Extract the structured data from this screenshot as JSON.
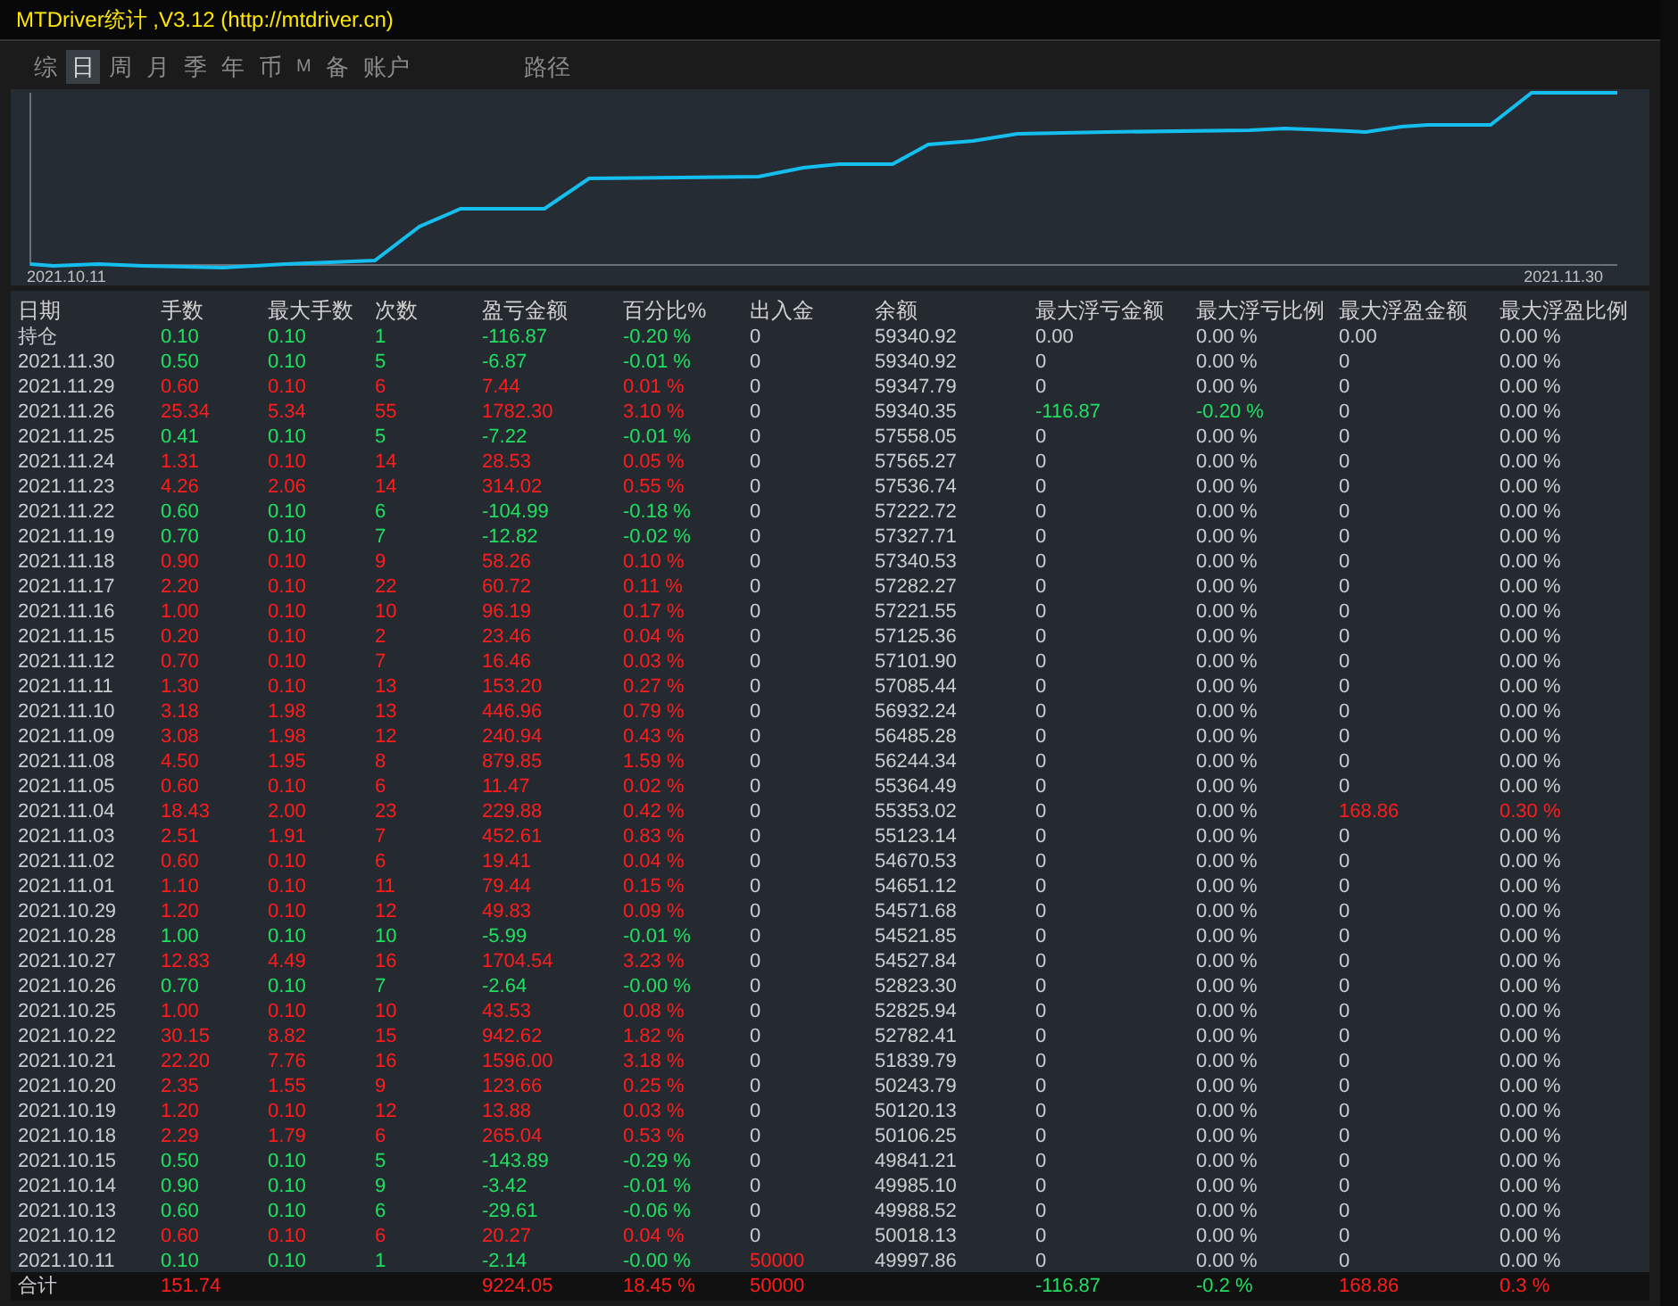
{
  "window": {
    "title": "MTDriver统计 ,V3.12 (http://mtdriver.cn)"
  },
  "tabs": [
    {
      "label": "综",
      "selected": false
    },
    {
      "label": "日",
      "selected": true
    },
    {
      "label": "周",
      "selected": false
    },
    {
      "label": "月",
      "selected": false
    },
    {
      "label": "季",
      "selected": false
    },
    {
      "label": "年",
      "selected": false
    },
    {
      "label": "币",
      "selected": false
    },
    {
      "label": "M",
      "selected": false
    },
    {
      "label": "备",
      "selected": false
    },
    {
      "label": "账户",
      "selected": false
    },
    {
      "label": "路径",
      "selected": false
    }
  ],
  "chart": {
    "start_label": "2021.10.11",
    "end_label": "2021.11.30"
  },
  "table": {
    "columns": [
      "日期",
      "手数",
      "最大手数",
      "次数",
      "盈亏金额",
      "百分比%",
      "出入金",
      "余额",
      "最大浮亏金额",
      "最大浮亏比例",
      "最大浮盈金额",
      "最大浮盈比例"
    ],
    "rows": [
      {
        "color": "#1fe060",
        "cells": [
          "持仓",
          "0.10",
          "0.10",
          "1",
          "-116.87",
          "-0.20 %",
          "0",
          "59340.92",
          "0.00",
          "0.00 %",
          "0.00",
          "0.00 %"
        ]
      },
      {
        "color": "#1fe060",
        "cells": [
          "2021.11.30",
          "0.50",
          "0.10",
          "5",
          "-6.87",
          "-0.01 %",
          "0",
          "59340.92",
          "0",
          "0.00 %",
          "0",
          "0.00 %"
        ]
      },
      {
        "color": "#ff1c1c",
        "cells": [
          "2021.11.29",
          "0.60",
          "0.10",
          "6",
          "7.44",
          "0.01 %",
          "0",
          "59347.79",
          "0",
          "0.00 %",
          "0",
          "0.00 %"
        ]
      },
      {
        "color": "#ff1c1c",
        "cells": [
          "2021.11.26",
          "25.34",
          "5.34",
          "55",
          "1782.30",
          "3.10 %",
          "0",
          "59340.35",
          {
            "text": "-116.87",
            "color": "#1fe060"
          },
          {
            "text": "-0.20 %",
            "color": "#1fe060"
          },
          "0",
          "0.00 %"
        ]
      },
      {
        "color": "#1fe060",
        "cells": [
          "2021.11.25",
          "0.41",
          "0.10",
          "5",
          "-7.22",
          "-0.01 %",
          "0",
          "57558.05",
          "0",
          "0.00 %",
          "0",
          "0.00 %"
        ]
      },
      {
        "color": "#ff1c1c",
        "cells": [
          "2021.11.24",
          "1.31",
          "0.10",
          "14",
          "28.53",
          "0.05 %",
          "0",
          "57565.27",
          "0",
          "0.00 %",
          "0",
          "0.00 %"
        ]
      },
      {
        "color": "#ff1c1c",
        "cells": [
          "2021.11.23",
          "4.26",
          "2.06",
          "14",
          "314.02",
          "0.55 %",
          "0",
          "57536.74",
          "0",
          "0.00 %",
          "0",
          "0.00 %"
        ]
      },
      {
        "color": "#1fe060",
        "cells": [
          "2021.11.22",
          "0.60",
          "0.10",
          "6",
          "-104.99",
          "-0.18 %",
          "0",
          "57222.72",
          "0",
          "0.00 %",
          "0",
          "0.00 %"
        ]
      },
      {
        "color": "#1fe060",
        "cells": [
          "2021.11.19",
          "0.70",
          "0.10",
          "7",
          "-12.82",
          "-0.02 %",
          "0",
          "57327.71",
          "0",
          "0.00 %",
          "0",
          "0.00 %"
        ]
      },
      {
        "color": "#ff1c1c",
        "cells": [
          "2021.11.18",
          "0.90",
          "0.10",
          "9",
          "58.26",
          "0.10 %",
          "0",
          "57340.53",
          "0",
          "0.00 %",
          "0",
          "0.00 %"
        ]
      },
      {
        "color": "#ff1c1c",
        "cells": [
          "2021.11.17",
          "2.20",
          "0.10",
          "22",
          "60.72",
          "0.11 %",
          "0",
          "57282.27",
          "0",
          "0.00 %",
          "0",
          "0.00 %"
        ]
      },
      {
        "color": "#ff1c1c",
        "cells": [
          "2021.11.16",
          "1.00",
          "0.10",
          "10",
          "96.19",
          "0.17 %",
          "0",
          "57221.55",
          "0",
          "0.00 %",
          "0",
          "0.00 %"
        ]
      },
      {
        "color": "#ff1c1c",
        "cells": [
          "2021.11.15",
          "0.20",
          "0.10",
          "2",
          "23.46",
          "0.04 %",
          "0",
          "57125.36",
          "0",
          "0.00 %",
          "0",
          "0.00 %"
        ]
      },
      {
        "color": "#ff1c1c",
        "cells": [
          "2021.11.12",
          "0.70",
          "0.10",
          "7",
          "16.46",
          "0.03 %",
          "0",
          "57101.90",
          "0",
          "0.00 %",
          "0",
          "0.00 %"
        ]
      },
      {
        "color": "#ff1c1c",
        "cells": [
          "2021.11.11",
          "1.30",
          "0.10",
          "13",
          "153.20",
          "0.27 %",
          "0",
          "57085.44",
          "0",
          "0.00 %",
          "0",
          "0.00 %"
        ]
      },
      {
        "color": "#ff1c1c",
        "cells": [
          "2021.11.10",
          "3.18",
          "1.98",
          "13",
          "446.96",
          "0.79 %",
          "0",
          "56932.24",
          "0",
          "0.00 %",
          "0",
          "0.00 %"
        ]
      },
      {
        "color": "#ff1c1c",
        "cells": [
          "2021.11.09",
          "3.08",
          "1.98",
          "12",
          "240.94",
          "0.43 %",
          "0",
          "56485.28",
          "0",
          "0.00 %",
          "0",
          "0.00 %"
        ]
      },
      {
        "color": "#ff1c1c",
        "cells": [
          "2021.11.08",
          "4.50",
          "1.95",
          "8",
          "879.85",
          "1.59 %",
          "0",
          "56244.34",
          "0",
          "0.00 %",
          "0",
          "0.00 %"
        ]
      },
      {
        "color": "#ff1c1c",
        "cells": [
          "2021.11.05",
          "0.60",
          "0.10",
          "6",
          "11.47",
          "0.02 %",
          "0",
          "55364.49",
          "0",
          "0.00 %",
          "0",
          "0.00 %"
        ]
      },
      {
        "color": "#ff1c1c",
        "cells": [
          "2021.11.04",
          "18.43",
          "2.00",
          "23",
          "229.88",
          "0.42 %",
          "0",
          "55353.02",
          "0",
          "0.00 %",
          {
            "text": "168.86",
            "color": "#ff1c1c"
          },
          {
            "text": "0.30 %",
            "color": "#ff1c1c"
          }
        ]
      },
      {
        "color": "#ff1c1c",
        "cells": [
          "2021.11.03",
          "2.51",
          "1.91",
          "7",
          "452.61",
          "0.83 %",
          "0",
          "55123.14",
          "0",
          "0.00 %",
          "0",
          "0.00 %"
        ]
      },
      {
        "color": "#ff1c1c",
        "cells": [
          "2021.11.02",
          "0.60",
          "0.10",
          "6",
          "19.41",
          "0.04 %",
          "0",
          "54670.53",
          "0",
          "0.00 %",
          "0",
          "0.00 %"
        ]
      },
      {
        "color": "#ff1c1c",
        "cells": [
          "2021.11.01",
          "1.10",
          "0.10",
          "11",
          "79.44",
          "0.15 %",
          "0",
          "54651.12",
          "0",
          "0.00 %",
          "0",
          "0.00 %"
        ]
      },
      {
        "color": "#ff1c1c",
        "cells": [
          "2021.10.29",
          "1.20",
          "0.10",
          "12",
          "49.83",
          "0.09 %",
          "0",
          "54571.68",
          "0",
          "0.00 %",
          "0",
          "0.00 %"
        ]
      },
      {
        "color": "#1fe060",
        "cells": [
          "2021.10.28",
          "1.00",
          "0.10",
          "10",
          "-5.99",
          "-0.01 %",
          "0",
          "54521.85",
          "0",
          "0.00 %",
          "0",
          "0.00 %"
        ]
      },
      {
        "color": "#ff1c1c",
        "cells": [
          "2021.10.27",
          "12.83",
          "4.49",
          "16",
          "1704.54",
          "3.23 %",
          "0",
          "54527.84",
          "0",
          "0.00 %",
          "0",
          "0.00 %"
        ]
      },
      {
        "color": "#1fe060",
        "cells": [
          "2021.10.26",
          "0.70",
          "0.10",
          "7",
          "-2.64",
          "-0.00 %",
          "0",
          "52823.30",
          "0",
          "0.00 %",
          "0",
          "0.00 %"
        ]
      },
      {
        "color": "#ff1c1c",
        "cells": [
          "2021.10.25",
          "1.00",
          "0.10",
          "10",
          "43.53",
          "0.08 %",
          "0",
          "52825.94",
          "0",
          "0.00 %",
          "0",
          "0.00 %"
        ]
      },
      {
        "color": "#ff1c1c",
        "cells": [
          "2021.10.22",
          "30.15",
          "8.82",
          "15",
          "942.62",
          "1.82 %",
          "0",
          "52782.41",
          "0",
          "0.00 %",
          "0",
          "0.00 %"
        ]
      },
      {
        "color": "#ff1c1c",
        "cells": [
          "2021.10.21",
          "22.20",
          "7.76",
          "16",
          "1596.00",
          "3.18 %",
          "0",
          "51839.79",
          "0",
          "0.00 %",
          "0",
          "0.00 %"
        ]
      },
      {
        "color": "#ff1c1c",
        "cells": [
          "2021.10.20",
          "2.35",
          "1.55",
          "9",
          "123.66",
          "0.25 %",
          "0",
          "50243.79",
          "0",
          "0.00 %",
          "0",
          "0.00 %"
        ]
      },
      {
        "color": "#ff1c1c",
        "cells": [
          "2021.10.19",
          "1.20",
          "0.10",
          "12",
          "13.88",
          "0.03 %",
          "0",
          "50120.13",
          "0",
          "0.00 %",
          "0",
          "0.00 %"
        ]
      },
      {
        "color": "#ff1c1c",
        "cells": [
          "2021.10.18",
          "2.29",
          "1.79",
          "6",
          "265.04",
          "0.53 %",
          "0",
          "50106.25",
          "0",
          "0.00 %",
          "0",
          "0.00 %"
        ]
      },
      {
        "color": "#1fe060",
        "cells": [
          "2021.10.15",
          "0.50",
          "0.10",
          "5",
          "-143.89",
          "-0.29 %",
          "0",
          "49841.21",
          "0",
          "0.00 %",
          "0",
          "0.00 %"
        ]
      },
      {
        "color": "#1fe060",
        "cells": [
          "2021.10.14",
          "0.90",
          "0.10",
          "9",
          "-3.42",
          "-0.01 %",
          "0",
          "49985.10",
          "0",
          "0.00 %",
          "0",
          "0.00 %"
        ]
      },
      {
        "color": "#1fe060",
        "cells": [
          "2021.10.13",
          "0.60",
          "0.10",
          "6",
          "-29.61",
          "-0.06 %",
          "0",
          "49988.52",
          "0",
          "0.00 %",
          "0",
          "0.00 %"
        ]
      },
      {
        "color": "#ff1c1c",
        "cells": [
          "2021.10.12",
          "0.60",
          "0.10",
          "6",
          "20.27",
          "0.04 %",
          "0",
          "50018.13",
          "0",
          "0.00 %",
          "0",
          "0.00 %"
        ]
      },
      {
        "color": "#1fe060",
        "cells": [
          "2021.10.11",
          "0.10",
          "0.10",
          "1",
          "-2.14",
          "-0.00 %",
          {
            "text": "50000",
            "color": "#ff1c1c"
          },
          "49997.86",
          "0",
          "0.00 %",
          "0",
          "0.00 %"
        ]
      }
    ],
    "totals": {
      "label": "合计",
      "lots": {
        "text": "151.74",
        "color": "#ff1c1c"
      },
      "profit": {
        "text": "9224.05",
        "color": "#ff1c1c"
      },
      "percent": {
        "text": "18.45 %",
        "color": "#ff1c1c"
      },
      "deposit": {
        "text": "50000",
        "color": "#ff1c1c"
      },
      "max_float_loss": {
        "text": "-116.87",
        "color": "#1fe060"
      },
      "max_float_loss_pct": {
        "text": "-0.2 %",
        "color": "#1fe060"
      },
      "max_float_profit": {
        "text": "168.86",
        "color": "#ff1c1c"
      },
      "max_float_profit_pct": {
        "text": "0.3 %",
        "color": "#ff1c1c"
      }
    }
  }
}
